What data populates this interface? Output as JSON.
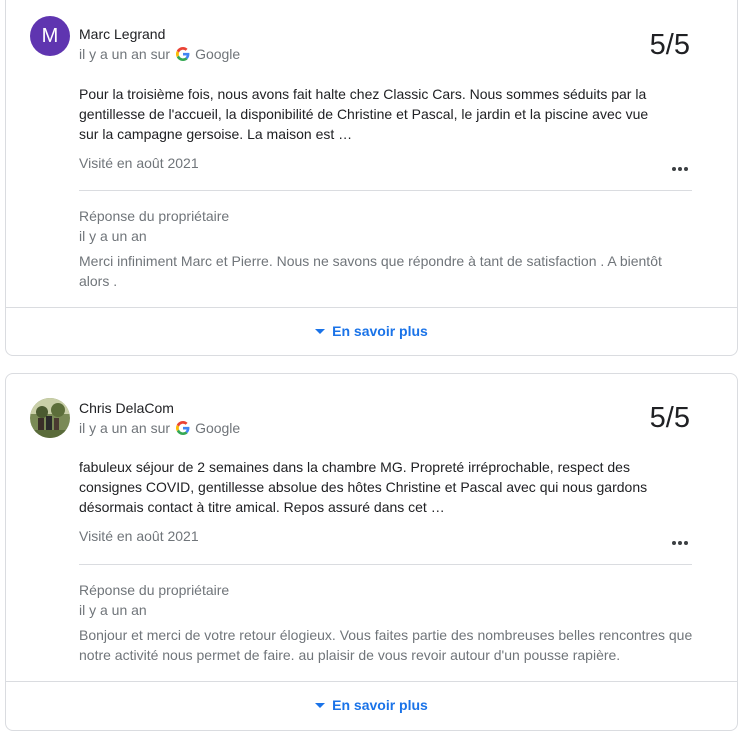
{
  "reviews": [
    {
      "author": "Marc Legrand",
      "avatar_letter": "M",
      "when": "il y a un an sur",
      "source": "Google",
      "score": "5/5",
      "text": "Pour la troisième fois, nous avons fait halte chez Classic Cars. Nous sommes séduits par la gentillesse de l'accueil, la disponibilité de Christine et Pascal, le jardin et la piscine avec vue sur la campagne gersoise. La maison est …",
      "visited": "Visité en août 2021",
      "owner_label": "Réponse du propriétaire",
      "owner_when": "il y a un an",
      "owner_text": "Merci infiniment Marc et Pierre. Nous ne savons que répondre à tant de satisfaction . A bientôt alors .",
      "learn_more": "En savoir plus"
    },
    {
      "author": "Chris DelaCom",
      "when": "il y a un an sur",
      "source": "Google",
      "score": "5/5",
      "text": "fabuleux séjour de 2 semaines dans la chambre MG. Propreté irréprochable, respect des consignes COVID, gentillesse absolue des hôtes Christine et Pascal avec qui nous gardons désormais contact à titre amical. Repos assuré dans cet …",
      "visited": "Visité en août 2021",
      "owner_label": "Réponse du propriétaire",
      "owner_when": "il y a un an",
      "owner_text": "Bonjour et merci de votre retour élogieux. Vous faites partie des nombreuses belles rencontres que notre activité nous permet de faire. au plaisir de vous revoir autour d'un pousse rapière.",
      "learn_more": "En savoir plus"
    }
  ],
  "icons": {
    "source": "google-g-icon",
    "menu": "more-horiz-icon",
    "expand": "caret-down-icon"
  },
  "colors": {
    "avatar_bg": "#5f35b0",
    "link": "#1a73e8",
    "muted": "#70757a"
  }
}
